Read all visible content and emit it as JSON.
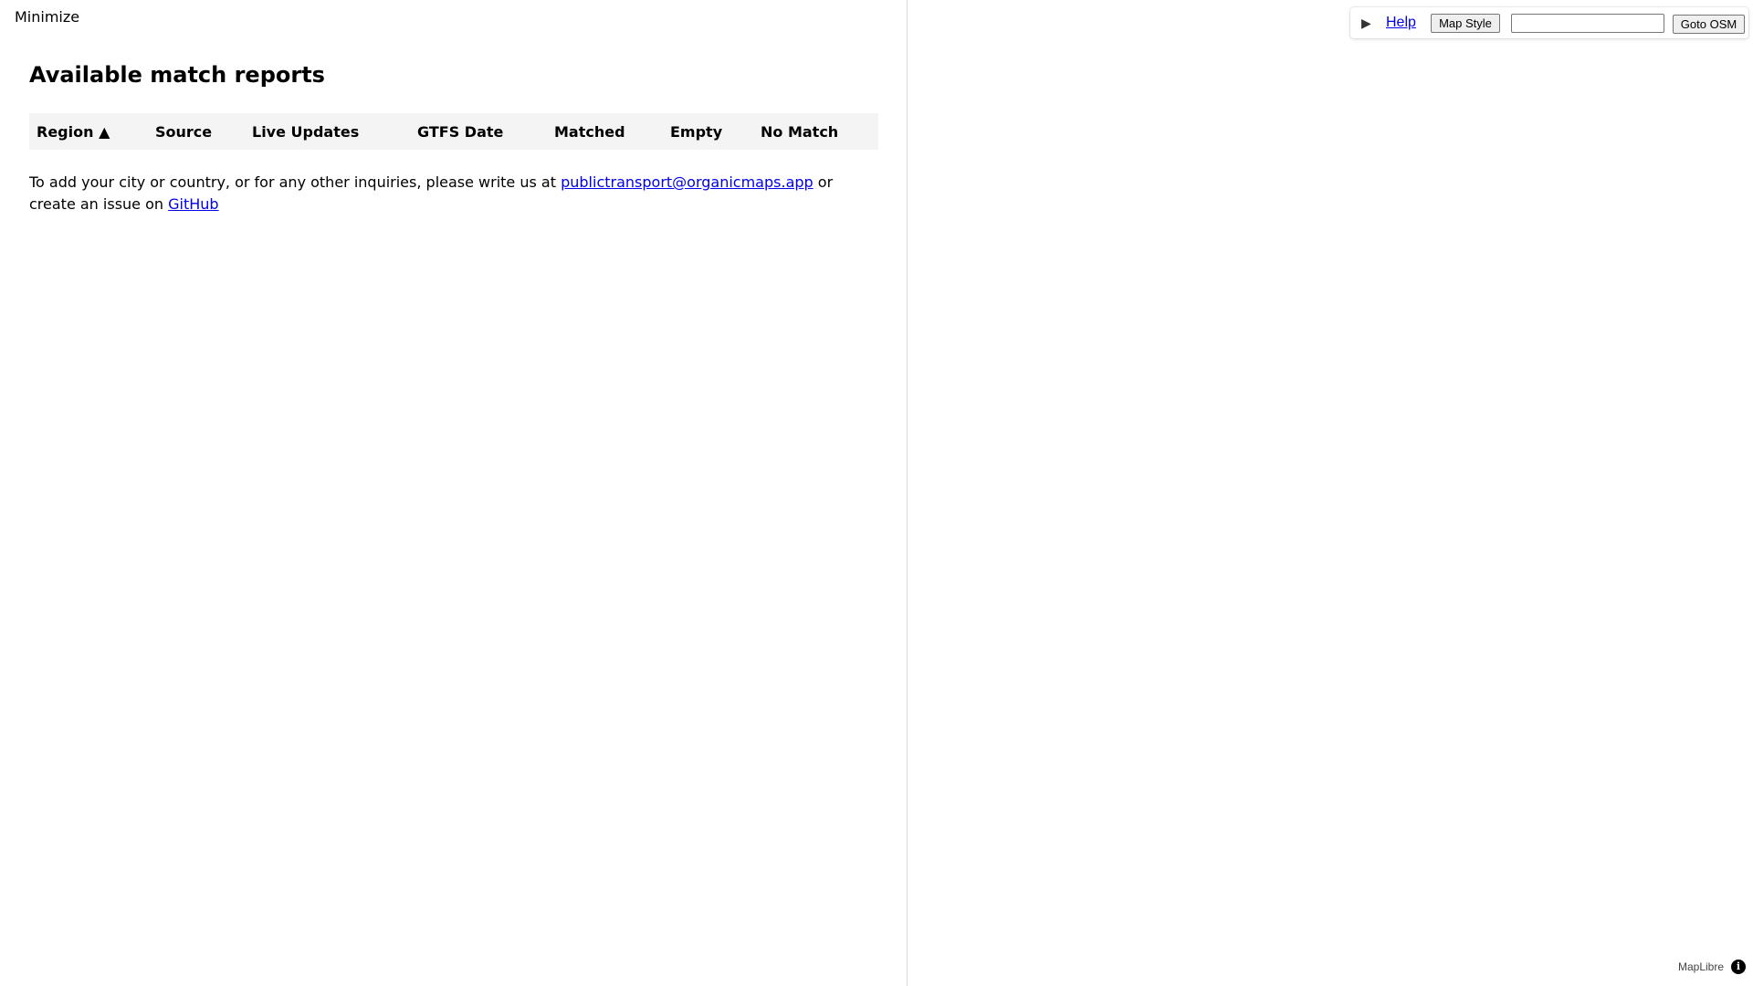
{
  "sidebar": {
    "minimize_label": "Minimize",
    "title": "Available match reports",
    "table": {
      "columns": [
        "Region ▲",
        "Source",
        "Live Updates",
        "GTFS Date",
        "Matched",
        "Empty",
        "No Match"
      ],
      "rows": []
    },
    "info": {
      "text_before": "To add your city or country, or for any other inquiries, please write us at ",
      "email_link": "publictransport@organicmaps.app",
      "text_middle": " or create an issue on ",
      "github_link": "GitHub"
    }
  },
  "map": {
    "toolbar": {
      "toggle_icon": "▶",
      "help_label": "Help",
      "map_style_label": "Map Style",
      "search_value": "",
      "goto_label": "Goto OSM"
    },
    "attribution": {
      "text": "MapLibre",
      "icon": "info-icon"
    }
  }
}
